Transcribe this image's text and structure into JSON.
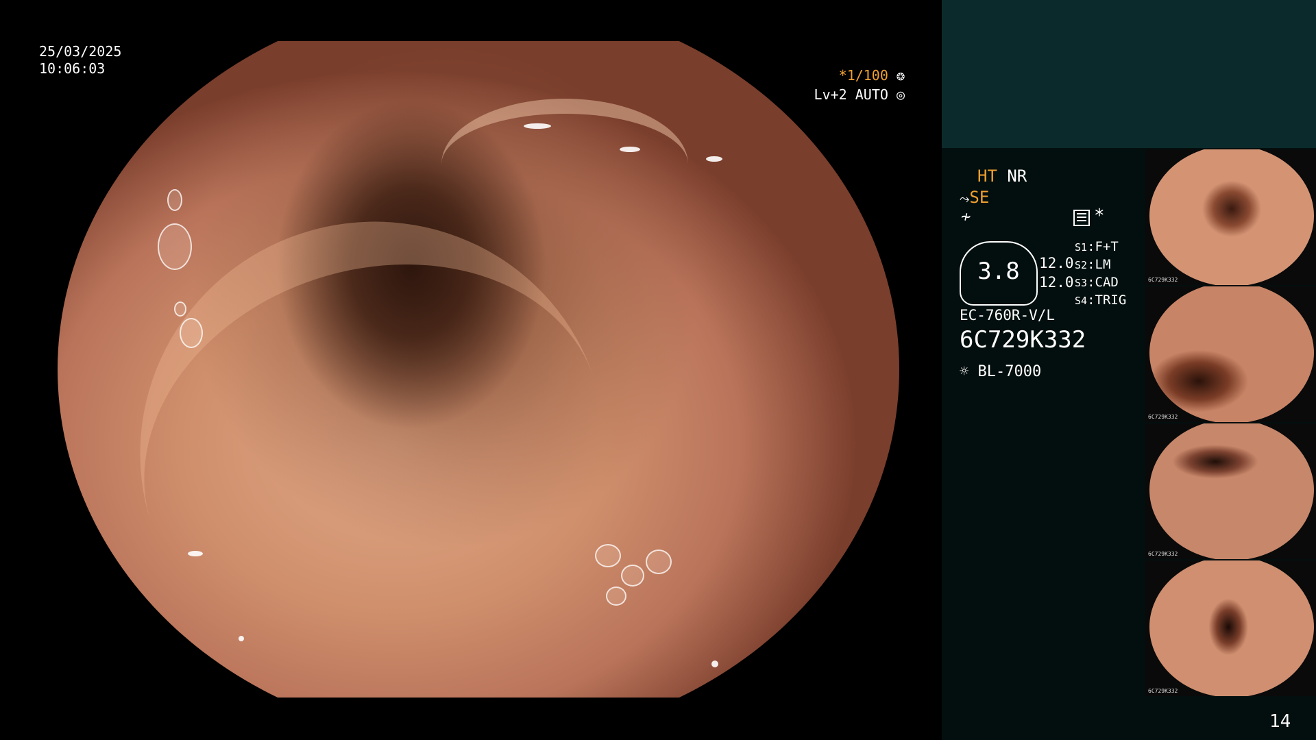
{
  "overlay": {
    "date": "25/03/2025",
    "time": "10:06:03",
    "shutter_star": "*",
    "shutter": "1/100",
    "shutter_icon": "aperture-icon",
    "level": "Lv+2 AUTO",
    "level_icon": "iris-icon"
  },
  "panel": {
    "ht": "HT",
    "nr": "NR",
    "se": "SE",
    "gauge_value": "3.8",
    "gauge_nums": [
      "12.0",
      "12.0"
    ],
    "switches": [
      {
        "key": "S1",
        "value": "F+T"
      },
      {
        "key": "S2",
        "value": "LM"
      },
      {
        "key": "S3",
        "value": "CAD"
      },
      {
        "key": "S4",
        "value": "TRIG"
      }
    ],
    "asterisk": "*",
    "model": "EC-760R-V/L",
    "serial": "6C729K332",
    "light_source": "BL-7000",
    "page_number": "14"
  },
  "thumbnails": [
    {
      "caption": "6C729K332"
    },
    {
      "caption": "6C729K332"
    },
    {
      "caption": "6C729K332"
    },
    {
      "caption": "6C729K332"
    }
  ],
  "colors": {
    "orange": "#f0a030",
    "panel_bg": "#030f0e",
    "panel_top_bg": "#0b2a2c"
  }
}
